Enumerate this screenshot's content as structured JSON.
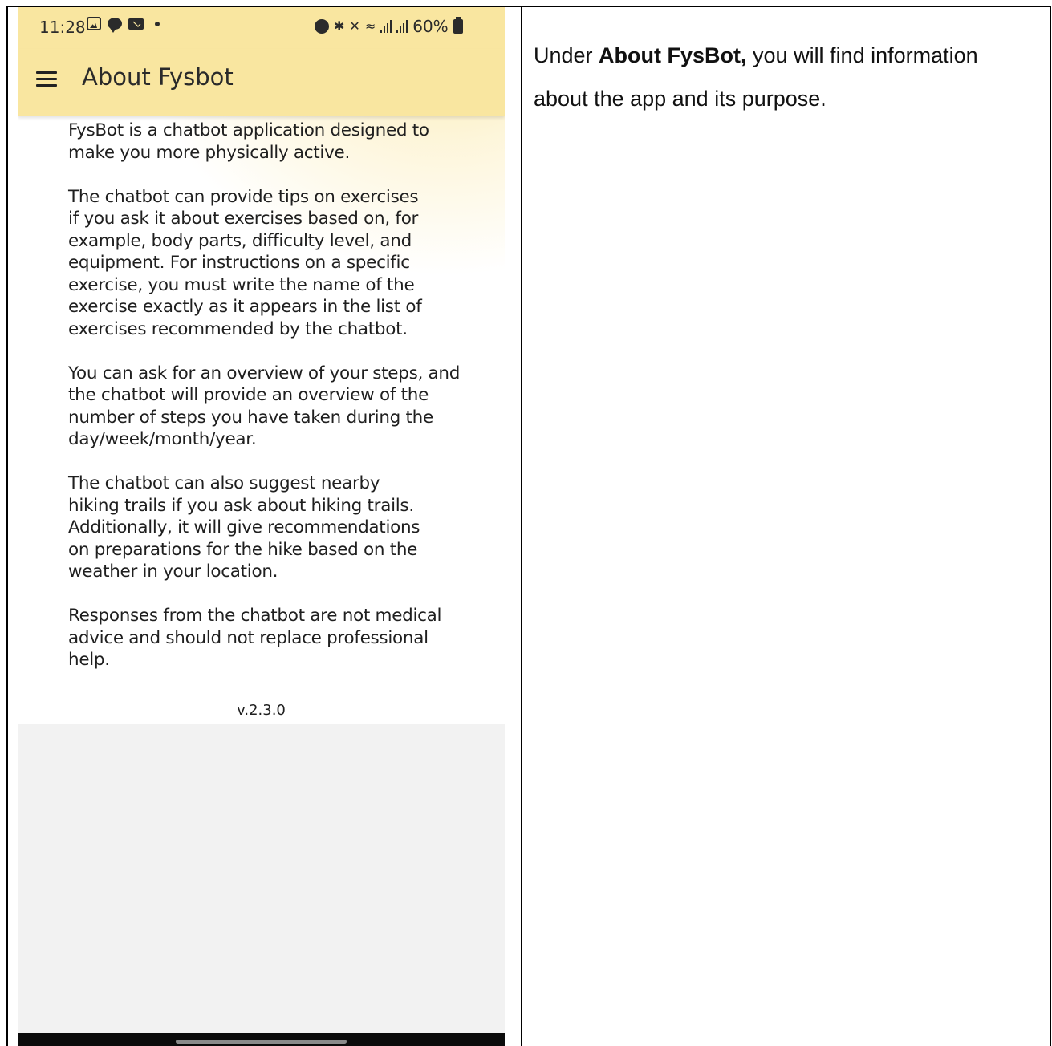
{
  "status_bar": {
    "time": "11:28",
    "battery": "60%"
  },
  "app_bar": {
    "title": "About Fysbot"
  },
  "about": {
    "paragraphs": [
      "FysBot is a chatbot application designed to\nmake you more physically active.",
      "The chatbot can provide tips on exercises\nif you ask it about exercises based on, for\nexample, body parts, difficulty level, and\nequipment. For instructions on a specific\nexercise, you must write the name of the\nexercise exactly as it appears in the list of\nexercises recommended by the chatbot.",
      "You can ask for an overview of your steps, and\nthe chatbot will provide an overview of the\nnumber of steps you have taken during the\nday/week/month/year.",
      "The chatbot can also suggest nearby\nhiking trails if you ask about hiking trails.\nAdditionally, it will give recommendations\non preparations for the hike based on the\nweather in your location.",
      "Responses from the chatbot are not medical\nadvice and should not replace professional\nhelp."
    ],
    "version": "v.2.3.0"
  },
  "description": {
    "prefix": "Under ",
    "bold": "About FysBot,",
    "suffix": " you will find information about the app and its purpose."
  },
  "colors": {
    "app_bar": "#f9e6a0",
    "grey_area": "#f2f2f2",
    "nav_bar": "#0b0b0b"
  },
  "icons": [
    "gallery-icon",
    "chat-icon",
    "mail-icon",
    "alarm-icon",
    "bluetooth-icon",
    "mute-icon",
    "wifi-icon",
    "signal-icon",
    "battery-icon",
    "menu-icon"
  ]
}
